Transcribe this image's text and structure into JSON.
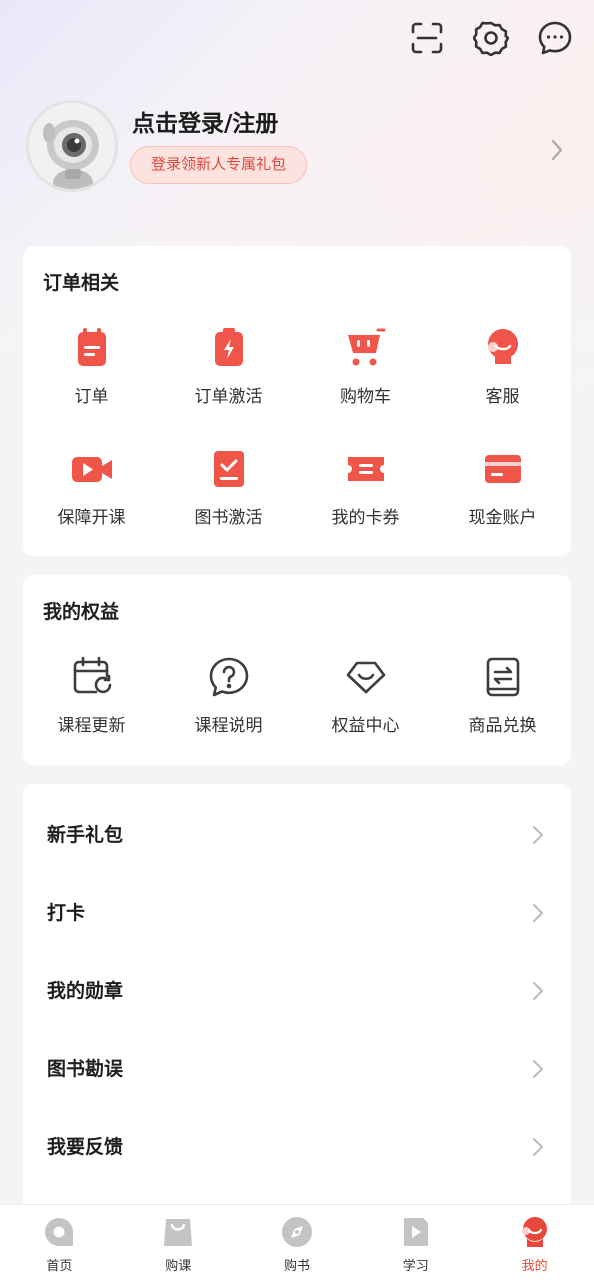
{
  "header": {
    "login_title": "点击登录/注册",
    "gift_label": "登录领新人专属礼包"
  },
  "orders": {
    "title": "订单相关",
    "items": [
      {
        "label": "订单",
        "icon": "order-icon"
      },
      {
        "label": "订单激活",
        "icon": "order-activate-icon"
      },
      {
        "label": "购物车",
        "icon": "cart-icon"
      },
      {
        "label": "客服",
        "icon": "customer-service-icon"
      },
      {
        "label": "保障开课",
        "icon": "video-icon"
      },
      {
        "label": "图书激活",
        "icon": "book-activate-icon"
      },
      {
        "label": "我的卡券",
        "icon": "coupon-icon"
      },
      {
        "label": "现金账户",
        "icon": "card-icon"
      }
    ]
  },
  "benefits": {
    "title": "我的权益",
    "items": [
      {
        "label": "课程更新",
        "icon": "calendar-refresh-icon"
      },
      {
        "label": "课程说明",
        "icon": "question-icon"
      },
      {
        "label": "权益中心",
        "icon": "benefit-icon"
      },
      {
        "label": "商品兑换",
        "icon": "exchange-icon"
      }
    ]
  },
  "menu": {
    "items": [
      {
        "label": "新手礼包"
      },
      {
        "label": "打卡"
      },
      {
        "label": "我的勋章"
      },
      {
        "label": "图书勘误"
      },
      {
        "label": "我要反馈"
      }
    ]
  },
  "tabbar": {
    "items": [
      {
        "label": "首页",
        "icon": "home-icon"
      },
      {
        "label": "购课",
        "icon": "bag-icon"
      },
      {
        "label": "购书",
        "icon": "compass-icon"
      },
      {
        "label": "学习",
        "icon": "play-icon"
      },
      {
        "label": "我的",
        "icon": "profile-icon"
      }
    ],
    "active": "我的"
  },
  "colors": {
    "accent": "#e8473b",
    "icon_red": "#f0554a",
    "outline_gray": "#3d3d3d"
  }
}
